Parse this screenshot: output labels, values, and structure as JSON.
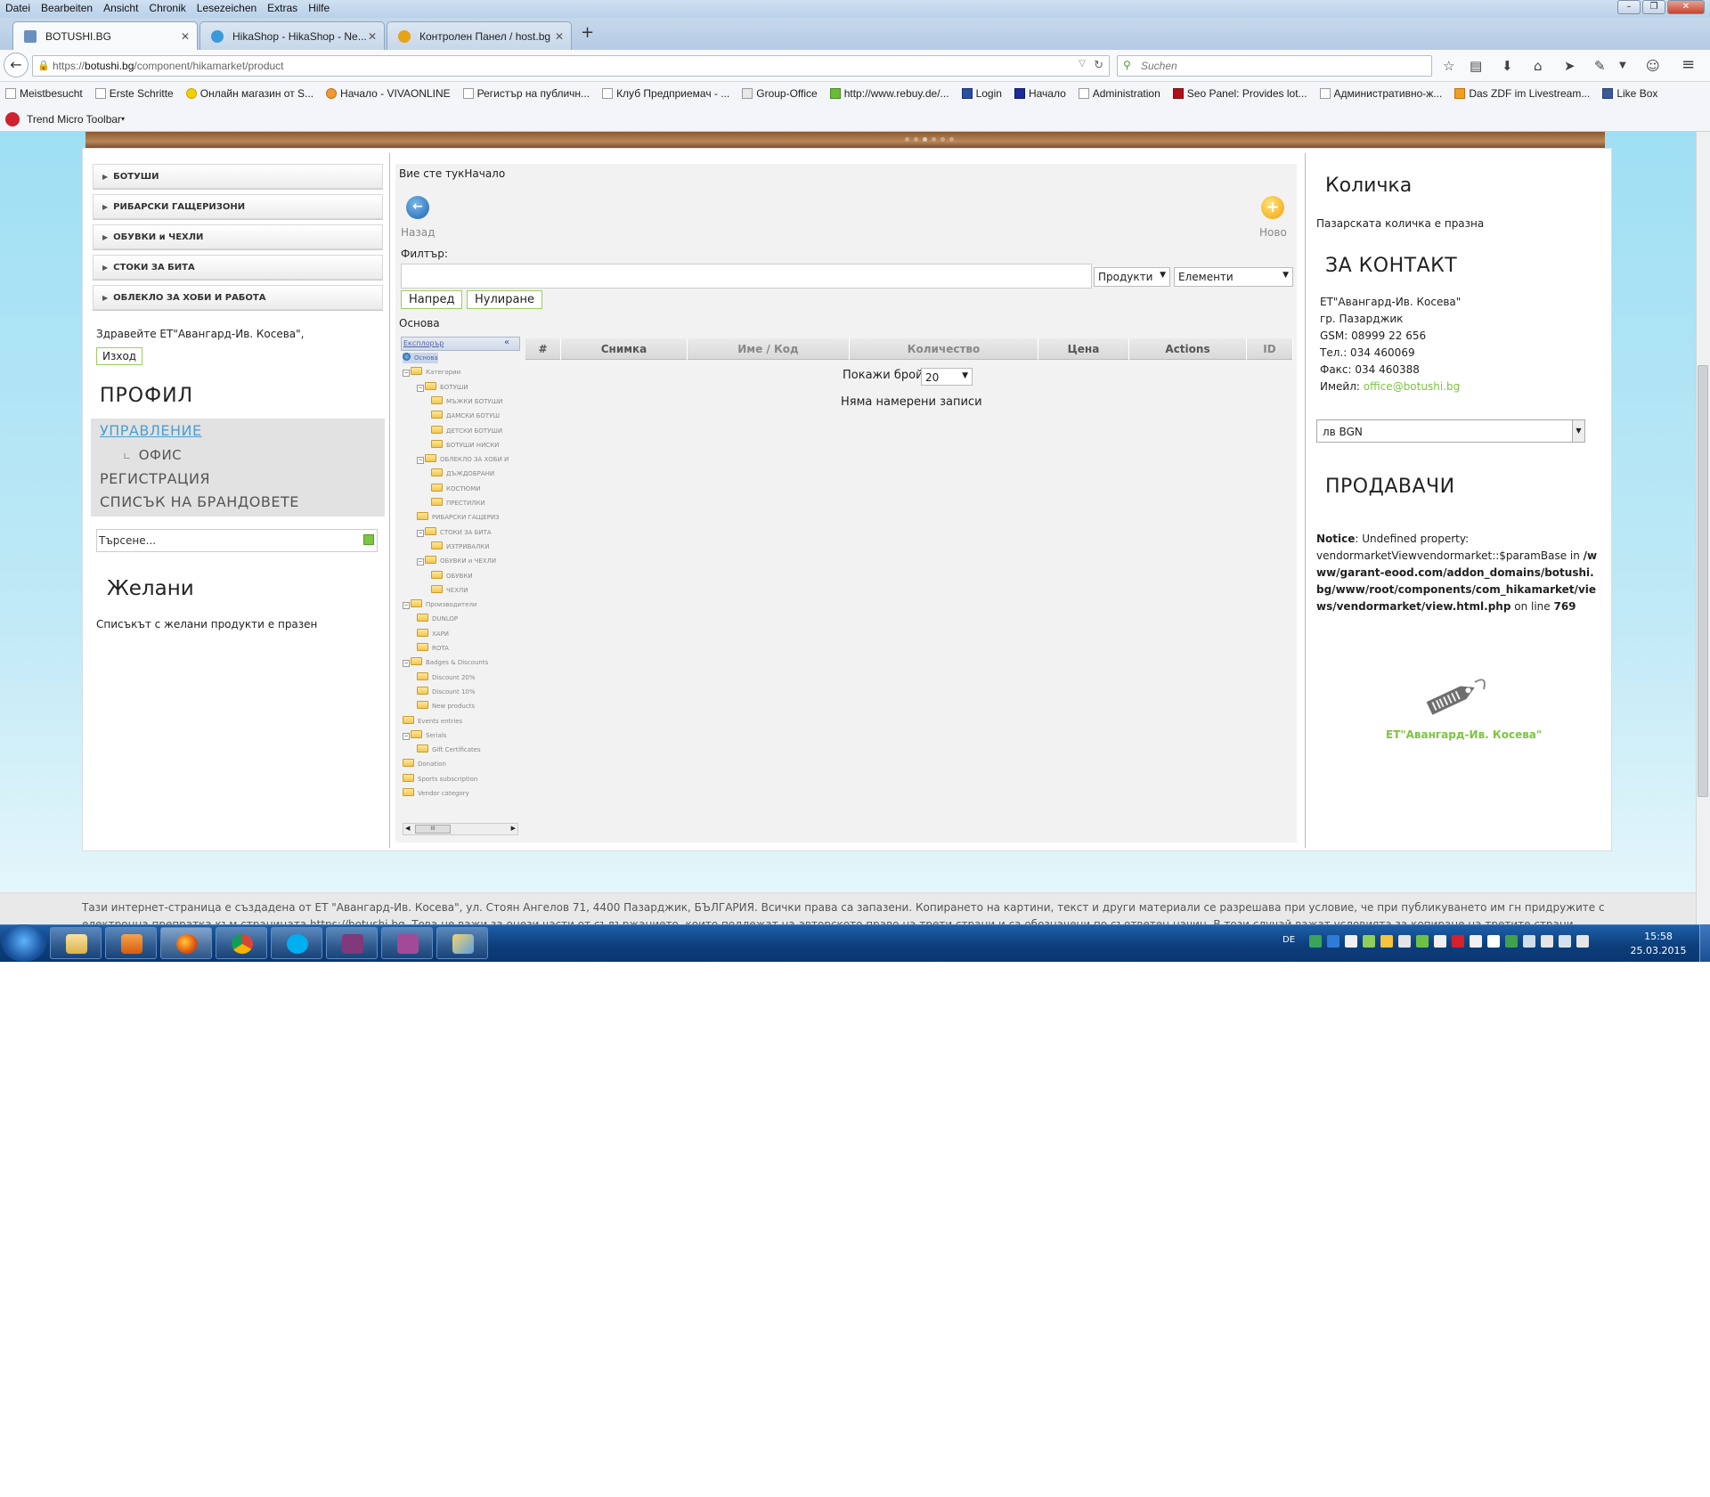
{
  "browser": {
    "menu": [
      "Datei",
      "Bearbeiten",
      "Ansicht",
      "Chronik",
      "Lesezeichen",
      "Extras",
      "Hilfe"
    ],
    "tabs": [
      {
        "label": "BOTUSHI.BG"
      },
      {
        "label": "HikaShop - HikaShop - Ne..."
      },
      {
        "label": "Контролен Панел / host.bg"
      }
    ],
    "url_prefix": "https://",
    "url_host": "botushi.bg",
    "url_path": "/component/hikamarket/product",
    "search_placeholder": "Suchen",
    "bookmarks": [
      "Meistbesucht",
      "Erste Schritte",
      "Онлайн магазин от S...",
      "Начало - VIVAONLINE",
      "Регистър на публичн...",
      "Клуб Предприемач - ...",
      "Group-Office",
      "http://www.rebuy.de/...",
      "Login",
      "Начало",
      "Administration",
      "Seo Panel: Provides lot...",
      "Административно-ж...",
      "Das ZDF im Livestream...",
      "Like Box"
    ],
    "toolbar2": "Trend Micro Toolbar"
  },
  "left": {
    "categories": [
      "БОТУШИ",
      "РИБАРСКИ ГАЩЕРИЗОНИ",
      "ОБУВКИ и ЧЕХЛИ",
      "СТОКИ ЗА БИТА",
      "ОБЛЕКЛО ЗА ХОБИ И РАБОТА"
    ],
    "hello": "Здравейте ЕТ\"Авангард-Ив. Косева\",",
    "logout": "Изход",
    "profile_title": "ПРОФИЛ",
    "menu": {
      "manage": "УПРАВЛЕНИЕ",
      "office": "ОФИС",
      "register": "РЕГИСТРАЦИЯ",
      "brands": "СПИСЪК НА БРАНДОВЕТЕ"
    },
    "search_value": "Търсене...",
    "wish_title": "Желани",
    "wish_empty": "Списъкът с желани продукти е празен"
  },
  "center": {
    "breadcrumb": "Вие сте тукНачало",
    "back_label": "Назад",
    "new_label": "Ново",
    "filter_label": "Филтър:",
    "filter_value": "",
    "select_products": "Продукти",
    "select_elements": "Елементи",
    "btn_next": "Напред",
    "btn_reset": "Нулиране",
    "osnova": "Основа",
    "explorer_head": "Експлорър",
    "tree": [
      {
        "label": "Основа",
        "level": 0
      },
      {
        "label": "Категории",
        "level": 0
      },
      {
        "label": "БОТУШИ",
        "level": 1
      },
      {
        "label": "МЪЖКИ БОТУШИ",
        "level": 2
      },
      {
        "label": "ДАМСКИ БОТУШ",
        "level": 2
      },
      {
        "label": "ДЕТСКИ БОТУШИ",
        "level": 2
      },
      {
        "label": "БОТУШИ НИСКИ",
        "level": 2
      },
      {
        "label": "ОБЛЕКЛО ЗА ХОБИ И",
        "level": 1
      },
      {
        "label": "ДЪЖДОБРАНИ",
        "level": 2
      },
      {
        "label": "КОСТЮМИ",
        "level": 2
      },
      {
        "label": "ПРЕСТИЛКИ",
        "level": 2
      },
      {
        "label": "РИБАРСКИ ГАЩЕРИЗ",
        "level": 1
      },
      {
        "label": "СТОКИ ЗА БИТА",
        "level": 1
      },
      {
        "label": "ИЗТРИВАЛКИ",
        "level": 2
      },
      {
        "label": "ОБУВКИ и ЧЕХЛИ",
        "level": 1
      },
      {
        "label": "ОБУВКИ",
        "level": 2
      },
      {
        "label": "ЧЕХЛИ",
        "level": 2
      },
      {
        "label": "Производители",
        "level": 0
      },
      {
        "label": "DUNLOP",
        "level": 1
      },
      {
        "label": "ХАРИ",
        "level": 1
      },
      {
        "label": "ROTA",
        "level": 1
      },
      {
        "label": "Badges & Discounts",
        "level": 0
      },
      {
        "label": "Discount 20%",
        "level": 1
      },
      {
        "label": "Discount 10%",
        "level": 1
      },
      {
        "label": "New products",
        "level": 1
      },
      {
        "label": "Events entries",
        "level": 0
      },
      {
        "label": "Serials",
        "level": 0
      },
      {
        "label": "Gift Certificates",
        "level": 1
      },
      {
        "label": "Donation",
        "level": 0
      },
      {
        "label": "Sports subscription",
        "level": 0
      },
      {
        "label": "Vendor category",
        "level": 0
      }
    ],
    "columns": [
      "#",
      "Снимка",
      "Име / Код",
      "Количество",
      "Цена",
      "Actions",
      "ID"
    ],
    "pagesize_label": "Покажи брой",
    "pagesize_value": "20",
    "no_records": "Няма намерени записи"
  },
  "right": {
    "cart_title": "Количка",
    "cart_empty": "Пазарската количка е празна",
    "contact_title": "ЗА КОНТАКТ",
    "contact_lines": [
      "ЕТ\"Авангард-Ив. Косева\"",
      "гр. Пазарджик",
      "GSM: 08999 22 656",
      "Тел.: 034 460069",
      "Факс: 034 460388"
    ],
    "email_label": "Имейл:",
    "email": "office@botushi.bg",
    "currency": "лв BGN",
    "vendors_title": "ПРОДАВАЧИ",
    "notice_label": "Notice",
    "notice_text": ": Undefined property: vendormarketViewvendormarket::$paramBase in",
    "notice_path": "/www/garant-eood.com/addon_domains/botushi.bg/www/root/components/com_hikamarket/views/vendormarket/view.html.php",
    "notice_online": " on line ",
    "notice_line": "769",
    "vendor_name": "ЕТ\"Авангард-Ив. Косева\""
  },
  "footer": {
    "text": "Тази интернет-страница е създадена от ЕТ \"Авангард-Ив. Косева\", ул. Стоян Ангелов 71, 4400 Пазарджик, БЪЛГАРИЯ. Всички права са запазени. Копирането на картини, текст и други материали се разрешава при условие, че при публикуването им гн придружите с електронна препратка към страницата https://botushi.bg. Това не важи за онези части от съдържанието, които подлежат на авторското право на трети страни и са обозначени по съответен начин. В този случай важат условията за копиране на третите страни. Страницата е създадена при изполване на Joomla!"
  },
  "taskbar": {
    "lang": "DE",
    "time": "15:58",
    "date": "25.03.2015"
  },
  "colors": {
    "accent_green": "#7cc443",
    "link_blue": "#4a9fd2"
  }
}
